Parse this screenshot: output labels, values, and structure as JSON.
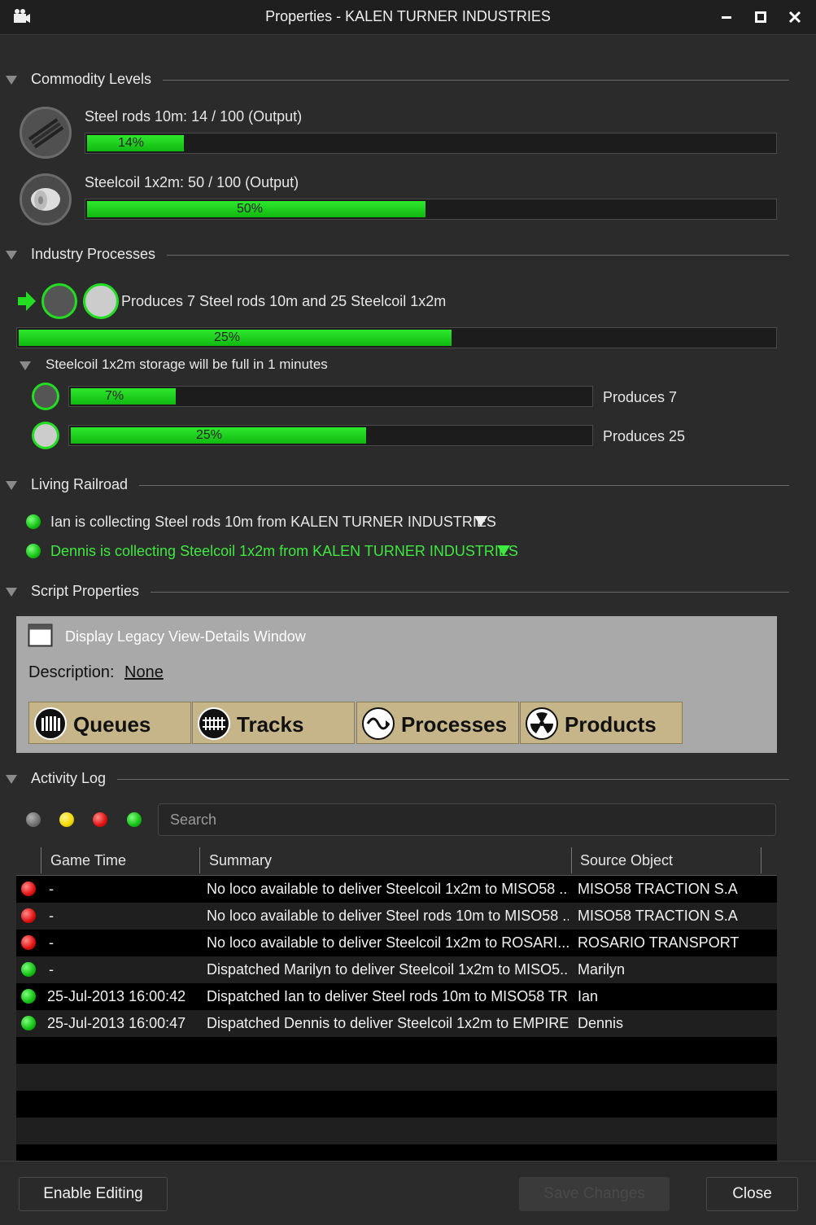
{
  "window": {
    "title": "Properties - KALEN TURNER INDUSTRIES"
  },
  "sections": {
    "commodity": "Commodity Levels",
    "processes": "Industry Processes",
    "living": "Living Railroad",
    "script": "Script Properties",
    "activity": "Activity Log"
  },
  "commodities": [
    {
      "label": "Steel rods 10m:  14 / 100  (Output)",
      "pct_label": "14%",
      "level": 0.14
    },
    {
      "label": "Steelcoil 1x2m:  50 / 100  (Output)",
      "pct_label": "50%",
      "level": 0.5
    }
  ],
  "process": {
    "title": "Produces 7 Steel rods 10m and 25 Steelcoil 1x2m",
    "pct_label": "25%",
    "level": 0.25,
    "storage_note": "Steelcoil 1x2m storage will be full in 1 minutes",
    "outputs": [
      {
        "pct_label": "7%",
        "level": 0.07,
        "label": "Produces 7"
      },
      {
        "pct_label": "25%",
        "level": 0.25,
        "label": "Produces 25"
      }
    ]
  },
  "living": [
    {
      "text": "Ian is collecting Steel rods 10m from KALEN TURNER INDUSTRIES",
      "color": "#e6e6e6"
    },
    {
      "text": "Dennis is collecting Steelcoil 1x2m from KALEN TURNER INDUSTRIES",
      "color": "#3fe83f"
    }
  ],
  "script": {
    "legacy_label": "Display Legacy View-Details Window",
    "description_label": "Description:",
    "description_value": "None",
    "buttons": [
      "Queues",
      "Tracks",
      "Processes",
      "Products"
    ]
  },
  "activity": {
    "search_placeholder": "Search",
    "columns": [
      "Game Time",
      "Summary",
      "Source Object"
    ],
    "rows": [
      {
        "status": "red",
        "time": "-",
        "summary": "No loco available to deliver Steelcoil 1x2m to MISO58 ...",
        "source": "MISO58 TRACTION S.A"
      },
      {
        "status": "red",
        "time": "-",
        "summary": "No loco available to deliver Steel rods 10m to MISO58 ...",
        "source": "MISO58 TRACTION S.A"
      },
      {
        "status": "red",
        "time": "-",
        "summary": "No loco available to deliver Steelcoil 1x2m to ROSARI...",
        "source": "ROSARIO TRANSPORT"
      },
      {
        "status": "green",
        "time": "-",
        "summary": "Dispatched Marilyn to deliver Steelcoil 1x2m to MISO5...",
        "source": "Marilyn"
      },
      {
        "status": "green",
        "time": "25-Jul-2013 16:00:42",
        "summary": "Dispatched Ian to deliver Steel rods 10m to MISO58 TR...",
        "source": "Ian"
      },
      {
        "status": "green",
        "time": "25-Jul-2013 16:00:47",
        "summary": "Dispatched Dennis to deliver Steelcoil 1x2m to EMPIRE...",
        "source": "Dennis"
      }
    ]
  },
  "footer": {
    "enable_editing": "Enable Editing",
    "save_changes": "Save Changes",
    "close": "Close"
  }
}
